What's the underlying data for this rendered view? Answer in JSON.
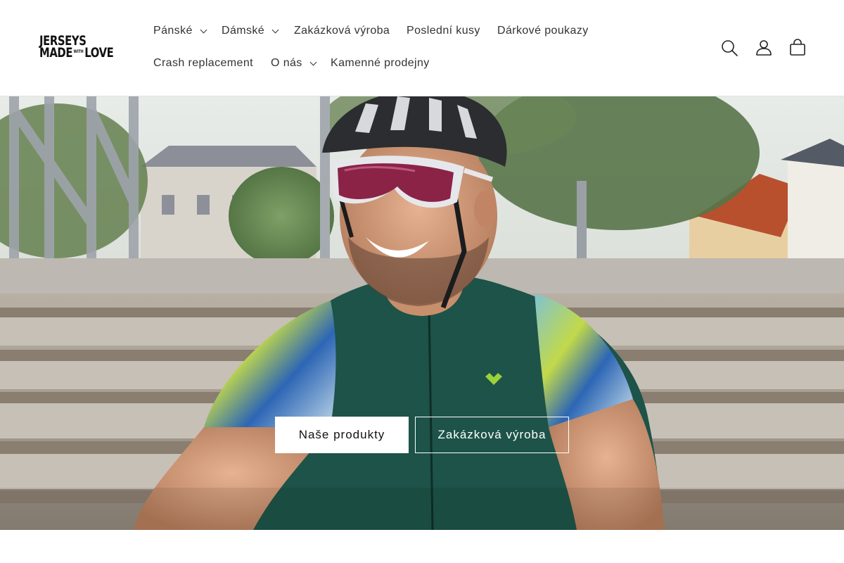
{
  "brand": {
    "line1": "JERSEYS",
    "line2_left": "MADE",
    "line2_small": "WITH",
    "line2_right": "LOVE"
  },
  "nav": {
    "items": [
      {
        "label": "Pánské",
        "has_dropdown": true
      },
      {
        "label": "Dámské",
        "has_dropdown": true
      },
      {
        "label": "Zakázková výroba",
        "has_dropdown": false
      },
      {
        "label": "Poslední kusy",
        "has_dropdown": false
      },
      {
        "label": "Dárkové poukazy",
        "has_dropdown": false
      },
      {
        "label": "Crash replacement",
        "has_dropdown": false
      },
      {
        "label": "O nás",
        "has_dropdown": true
      },
      {
        "label": "Kamenné prodejny",
        "has_dropdown": false
      }
    ]
  },
  "header_icons": [
    "search-icon",
    "account-icon",
    "cart-icon"
  ],
  "hero": {
    "primary_button": "Naše produkty",
    "secondary_button": "Zakázková výroba"
  },
  "colors": {
    "text": "#121212",
    "nav_text": "#333333",
    "jersey": "#1d5348",
    "button_bg": "#ffffff"
  }
}
